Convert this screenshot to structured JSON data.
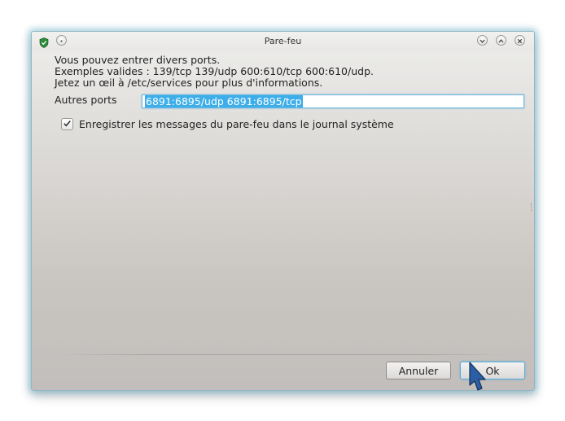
{
  "window": {
    "title": "Pare-feu"
  },
  "info": {
    "line1": "Vous pouvez entrer divers ports.",
    "line2": "Exemples valides : 139/tcp 139/udp 600:610/tcp 600:610/udp.",
    "line3": "Jetez un œil à /etc/services pour plus d'informations."
  },
  "ports": {
    "label": "Autres ports",
    "value": "6891:6895/udp 6891:6895/tcp"
  },
  "log": {
    "label": "Enregistrer les messages du pare-feu dans le journal système",
    "checked": true
  },
  "buttons": {
    "cancel": "Annuler",
    "ok": "Ok"
  },
  "icons": {
    "app": "shield-icon",
    "menu": "dot-icon",
    "minimize": "chevron-down-icon",
    "maximize": "chevron-up-icon",
    "close": "close-icon"
  },
  "colors": {
    "accent": "#3daee9",
    "shield": "#2e8b3a"
  }
}
